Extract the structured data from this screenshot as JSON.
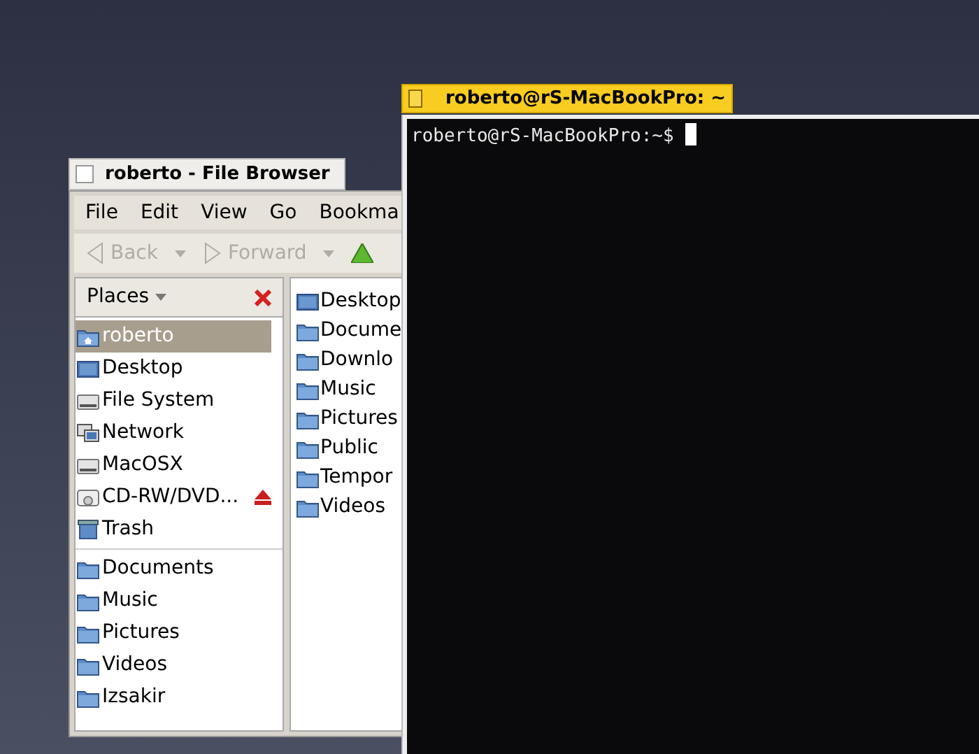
{
  "file_browser": {
    "title": "roberto - File Browser",
    "menu": [
      "File",
      "Edit",
      "View",
      "Go",
      "Bookma"
    ],
    "toolbar": [
      {
        "label": "Back",
        "kind": "back",
        "disabled": true
      },
      {
        "label": "Forward",
        "kind": "forward",
        "disabled": true
      }
    ],
    "side_pane": {
      "header": "Places",
      "places": [
        {
          "label": "roberto",
          "kind": "home",
          "selected": true,
          "eject": false
        },
        {
          "label": "Desktop",
          "kind": "desktop",
          "selected": false,
          "eject": false
        },
        {
          "label": "File System",
          "kind": "drive",
          "selected": false,
          "eject": false
        },
        {
          "label": "Network",
          "kind": "network",
          "selected": false,
          "eject": false
        },
        {
          "label": "MacOSX",
          "kind": "drive",
          "selected": false,
          "eject": false
        },
        {
          "label": "CD-RW/DVD...",
          "kind": "optical",
          "selected": false,
          "eject": true
        },
        {
          "label": "Trash",
          "kind": "trash",
          "selected": false,
          "eject": false
        }
      ],
      "bookmarks": [
        {
          "label": "Documents",
          "kind": "folder",
          "selected": false
        },
        {
          "label": "Music",
          "kind": "folder",
          "selected": false
        },
        {
          "label": "Pictures",
          "kind": "folder",
          "selected": false
        },
        {
          "label": "Videos",
          "kind": "folder",
          "selected": false
        },
        {
          "label": "Izsakir",
          "kind": "folder",
          "selected": false
        }
      ]
    },
    "files": [
      {
        "name": "Desktop",
        "kind": "desktop"
      },
      {
        "name": "Docume",
        "kind": "folder"
      },
      {
        "name": "Downlo",
        "kind": "folder"
      },
      {
        "name": "Music",
        "kind": "folder"
      },
      {
        "name": "Pictures",
        "kind": "folder"
      },
      {
        "name": "Public",
        "kind": "folder"
      },
      {
        "name": "Tempor",
        "kind": "folder"
      },
      {
        "name": "Videos",
        "kind": "folder"
      }
    ]
  },
  "terminal": {
    "title": "roberto@rS-MacBookPro: ~",
    "prompt": "roberto@rS-MacBookPro:~$"
  }
}
